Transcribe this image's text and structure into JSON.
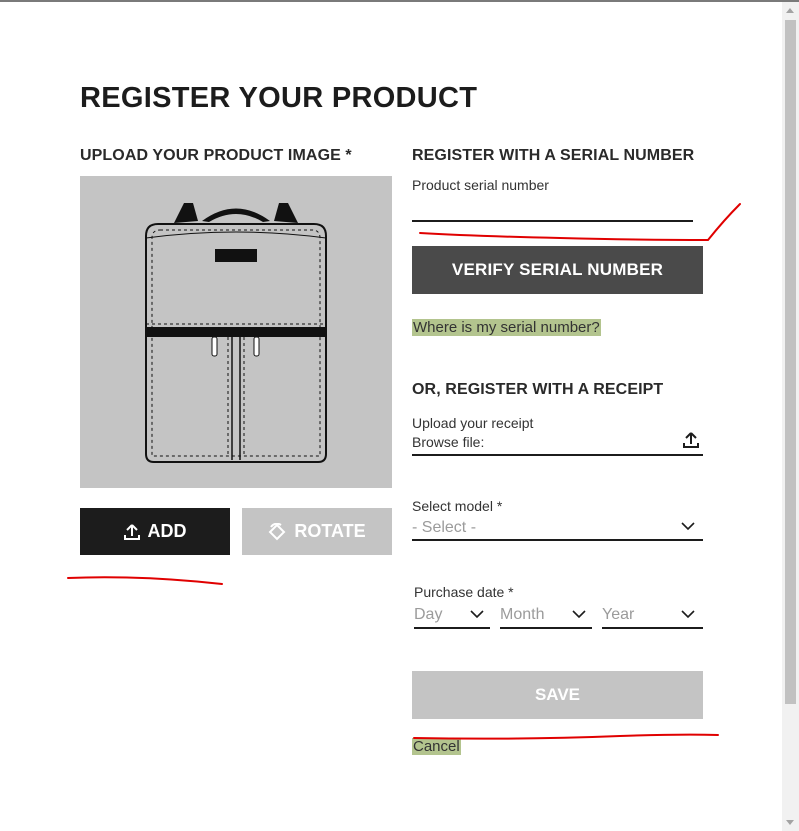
{
  "page": {
    "title": "REGISTER YOUR PRODUCT"
  },
  "image_section": {
    "label": "UPLOAD YOUR PRODUCT IMAGE *",
    "add_label": "ADD",
    "rotate_label": "ROTATE"
  },
  "serial_section": {
    "label": "REGISTER WITH A SERIAL NUMBER",
    "field_label": "Product serial number",
    "field_value": "",
    "verify_label": "VERIFY SERIAL NUMBER",
    "help_link": "Where is my serial number?"
  },
  "receipt_section": {
    "label": "OR, REGISTER WITH A RECEIPT",
    "upload_label": "Upload your receipt",
    "browse_label": "Browse file:",
    "model_label": "Select model  *",
    "model_placeholder": "- Select -",
    "purchase_label": "Purchase date  *",
    "day_placeholder": "Day",
    "month_placeholder": "Month",
    "year_placeholder": "Year"
  },
  "actions": {
    "save_label": "SAVE",
    "cancel_label": "Cancel"
  },
  "colors": {
    "primary_dark": "#1c1c1c",
    "verify_button": "#4a4a4a",
    "disabled_button": "#c4c4c4",
    "link_highlight": "#b3c48e",
    "annotation_red": "#e00000"
  },
  "icons": {
    "add": "upload-icon",
    "rotate": "rotate-icon",
    "browse": "upload-icon",
    "dropdown": "chevron-down-icon"
  }
}
